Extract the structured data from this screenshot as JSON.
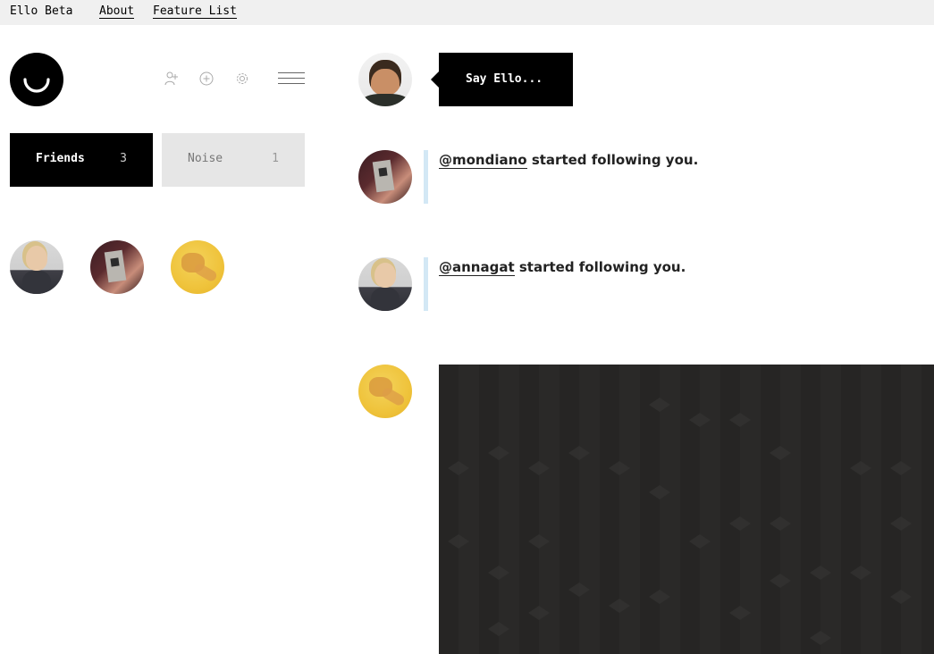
{
  "topbar": {
    "brand": "Ello Beta",
    "links": [
      {
        "label": "About"
      },
      {
        "label": "Feature List"
      }
    ]
  },
  "sidebar": {
    "tabs": [
      {
        "label": "Friends",
        "count": "3"
      },
      {
        "label": "Noise",
        "count": "1"
      }
    ],
    "friend_avatars": [
      "annagat",
      "mondiano",
      "fist"
    ]
  },
  "composer": {
    "placeholder": "Say Ello..."
  },
  "feed": {
    "notifications": [
      {
        "user": "@mondiano",
        "text": " started following you."
      },
      {
        "user": "@annagat",
        "text": " started following you."
      }
    ]
  },
  "colors": {
    "topbar_bg": "#f0f0f0",
    "active_tab": "#000000",
    "inactive_tab": "#e6e6e6",
    "notification_bar": "#d3e8f5",
    "post_image_bg": "#262524"
  }
}
